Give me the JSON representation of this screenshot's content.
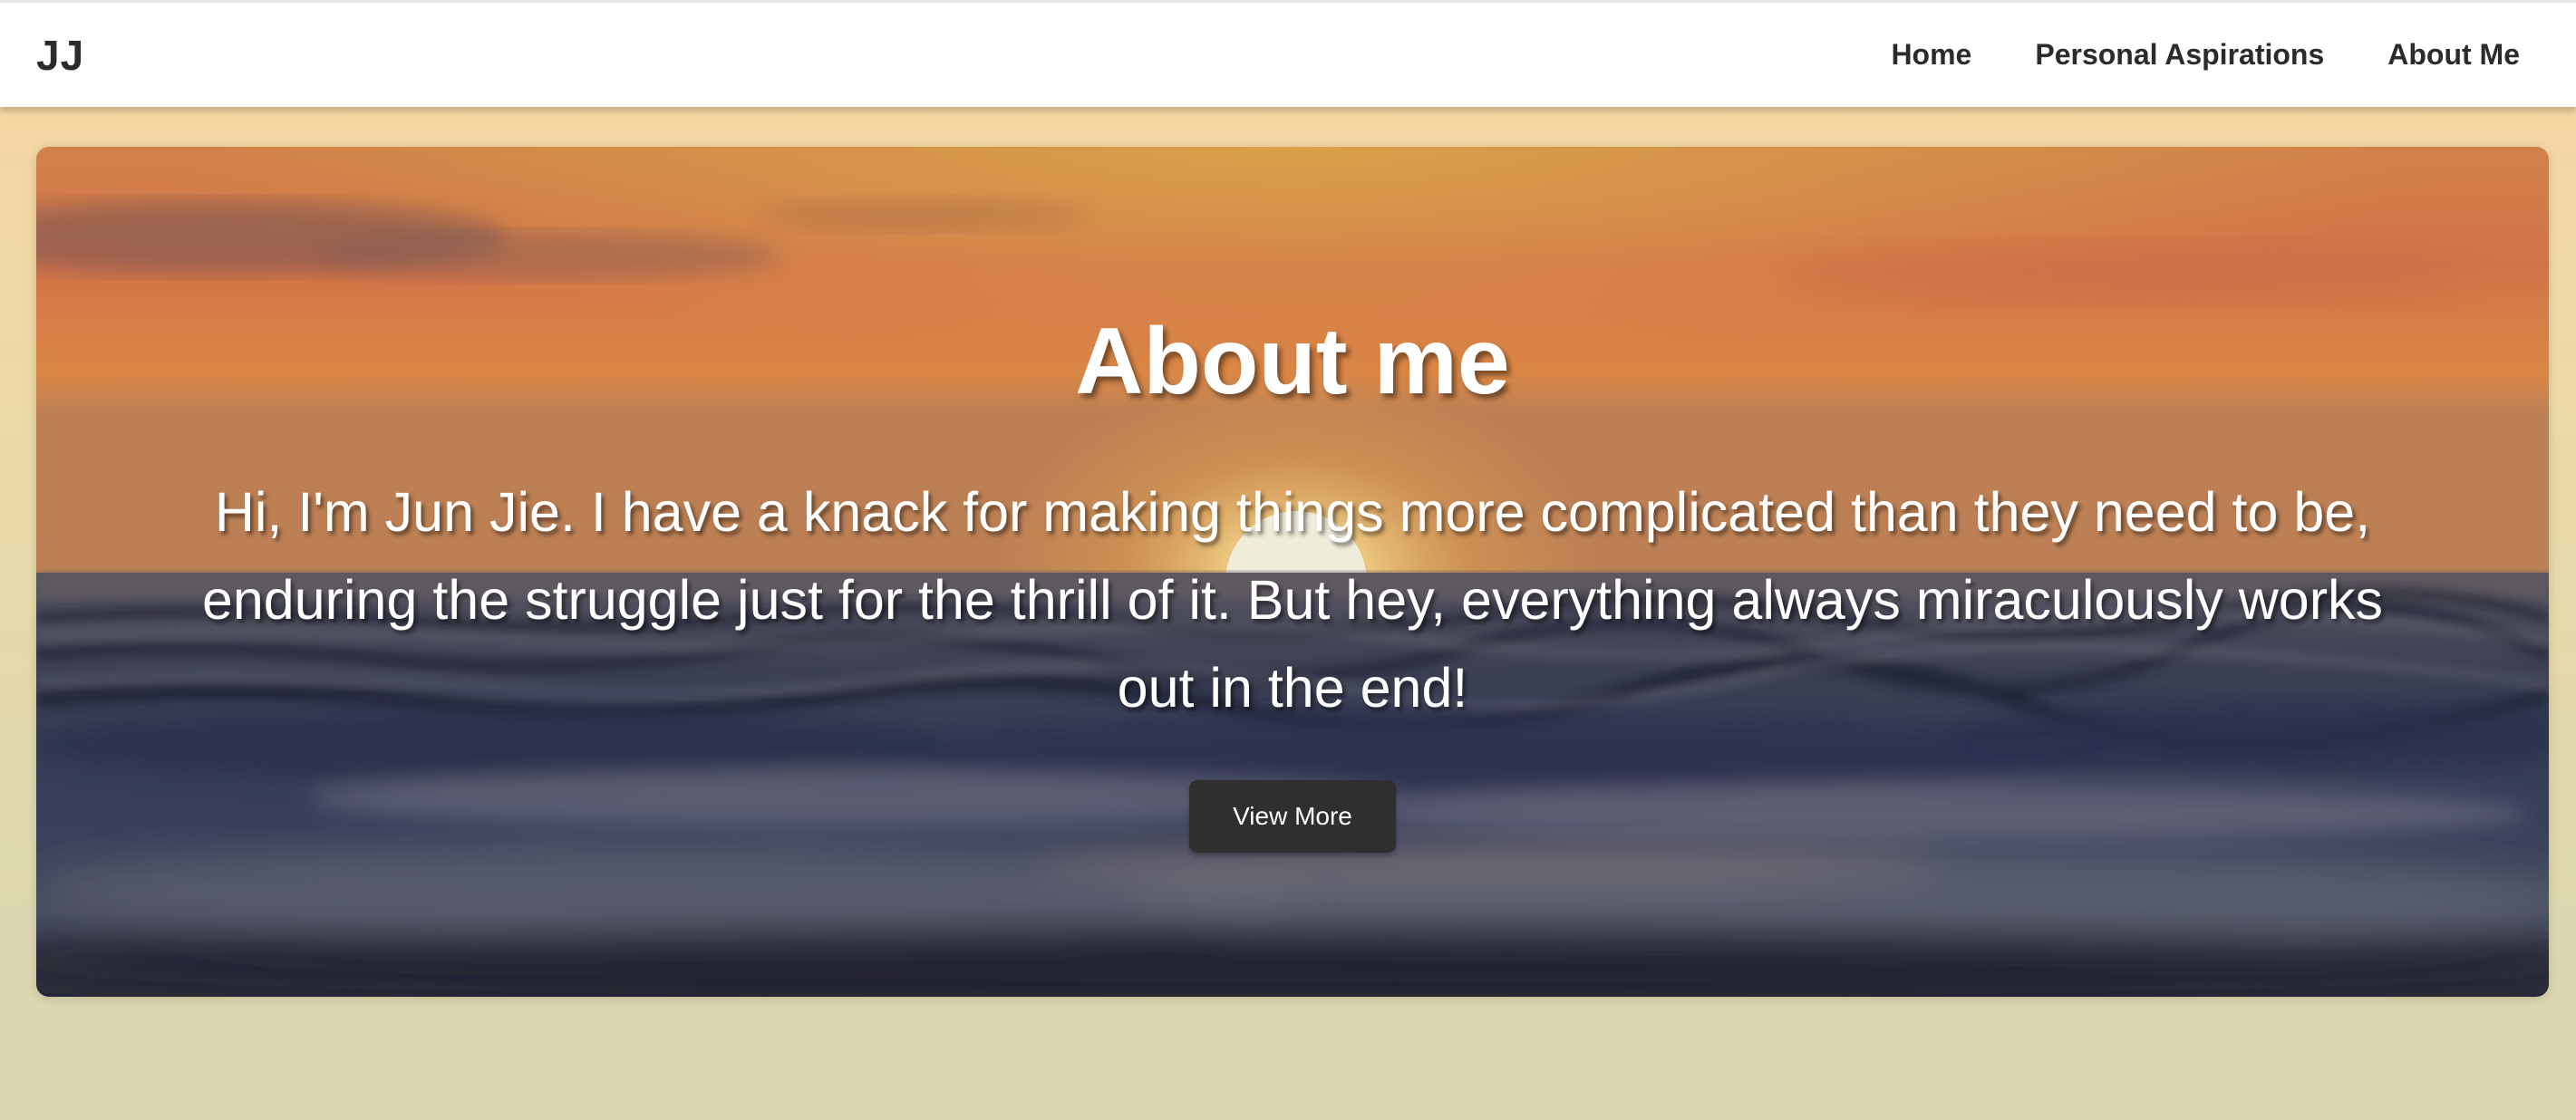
{
  "navbar": {
    "logo": "JJ",
    "links": [
      {
        "label": "Home"
      },
      {
        "label": "Personal Aspirations"
      },
      {
        "label": "About Me"
      }
    ]
  },
  "hero": {
    "title": "About me",
    "text": "Hi, I'm Jun Jie. I have a knack for making things more complicated than they need to be, enduring the struggle just for the thrill of it. But hey, everything always miraculously works out in the end!",
    "button_label": "View More",
    "image_description": "sunset-over-ocean-waves"
  },
  "colors": {
    "page_background_top": "#f7d59f",
    "page_background_bottom": "#d8d6b0",
    "navbar_background": "#ffffff",
    "nav_text": "#2b2b2b",
    "button_background": "#2f2f2f",
    "button_text": "#ffffff",
    "hero_text": "#ffffff"
  }
}
